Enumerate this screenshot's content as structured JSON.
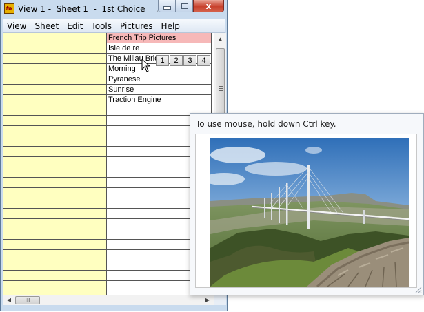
{
  "window": {
    "title": "View 1 -  Sheet 1  -  1st Choice    ...",
    "app_icon_text": "fw",
    "close_glyph": "x"
  },
  "menu": [
    "View",
    "Sheet",
    "Edit",
    "Tools",
    "Pictures",
    "Help"
  ],
  "rows": [
    "French Trip Pictures",
    "Isle de re",
    "The Millau Bridge",
    "Morning",
    "Pyranese",
    "Sunrise",
    "Traction Engine",
    "",
    "",
    "",
    "",
    "",
    "",
    "",
    "",
    "",
    "",
    "",
    "",
    "",
    "",
    "",
    "",
    "",
    "",
    ""
  ],
  "highlighted_row": 0,
  "page_tabs": [
    "1",
    "2",
    "3",
    "4"
  ],
  "scrollbar": {
    "hthumb_glyph": "III",
    "vthumb_glyph": "≡"
  },
  "picture_window": {
    "hint": "To use mouse, hold down Ctrl key.",
    "picture_subject": "Millau Viaduct bridge photo"
  },
  "colors": {
    "column_a_fill": "#ffffc0",
    "highlight_fill": "#f6b8b8",
    "close_button": "#c7402c"
  }
}
